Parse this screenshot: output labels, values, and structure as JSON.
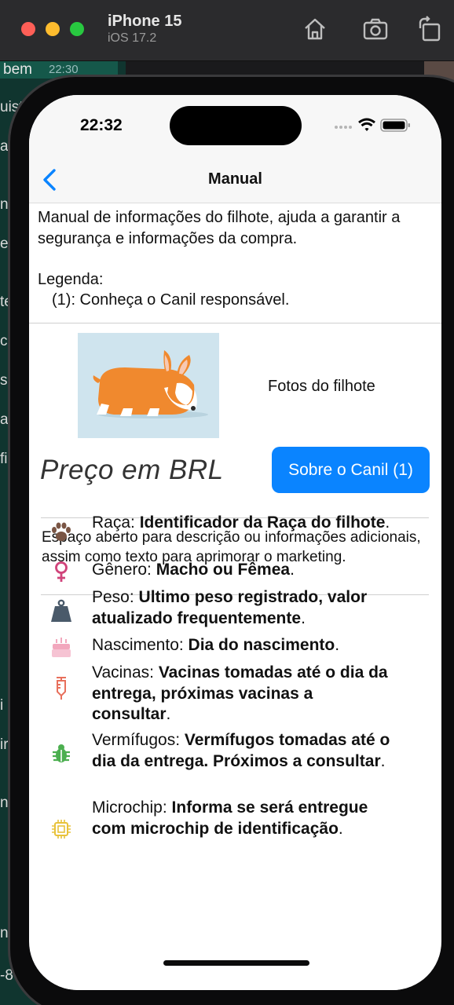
{
  "simulator": {
    "device_name": "iPhone 15",
    "os_version": "iOS 17.2",
    "buttons": [
      "home-icon",
      "screenshot-icon",
      "rotate-icon"
    ]
  },
  "background_app": {
    "rows": [
      "bem",
      "uist",
      "ag",
      "nk",
      "e",
      "te",
      "c",
      "s",
      "a",
      "fi",
      "i",
      "ir",
      "n",
      "n",
      "-8"
    ],
    "time": "22:30"
  },
  "status_bar": {
    "time": "22:32"
  },
  "nav": {
    "title": "Manual",
    "back_icon": "chevron-left-icon"
  },
  "intro": {
    "text": "Manual de informações do filhote, ajuda a garantir a segurança e informações da compra.",
    "legend_title": "Legenda:",
    "legend_item": "(1):  Conheça o Canil responsável."
  },
  "puppy": {
    "photos_label": "Fotos do filhote",
    "price_label": "Preço em BRL",
    "canil_button": "Sobre o Canil (1)"
  },
  "description": "Espaço aberto para descrição ou informações adicionais, assim como texto para aprimorar o marketing.",
  "info_items": [
    {
      "icon": "paw-icon",
      "label": "Raça: ",
      "value": "Identificador da Raça do filhote",
      "color": "#7a5544"
    },
    {
      "icon": "female-icon",
      "label": "Gênero: ",
      "value": "Macho ou Fêmea",
      "color": "#d0437a"
    },
    {
      "icon": "weight-icon",
      "label": "Peso: ",
      "value": "Ultimo peso registrado, valor atualizado frequentemente",
      "color": "#4a5a6a"
    },
    {
      "icon": "cake-icon",
      "label": "Nascimento: ",
      "value": "Dia do nascimento",
      "color": "#f2a7bd"
    },
    {
      "icon": "syringe-icon",
      "label": "Vacinas: ",
      "value": "Vacinas tomadas até o dia da entrega, próximas vacinas a consultar",
      "color": "#e8705c"
    },
    {
      "icon": "bug-icon",
      "label": "Vermífugos: ",
      "value": "Vermífugos tomadas até o dia da entrega. Próximos a consultar",
      "color": "#4caf50"
    },
    {
      "icon": "microchip-icon",
      "label": "Microchip: ",
      "value": "Informa se será entregue com microchip de identificação",
      "color": "#e8c23a"
    }
  ],
  "colors": {
    "accent": "#0a84ff",
    "navbar": "#f7f7f7"
  }
}
